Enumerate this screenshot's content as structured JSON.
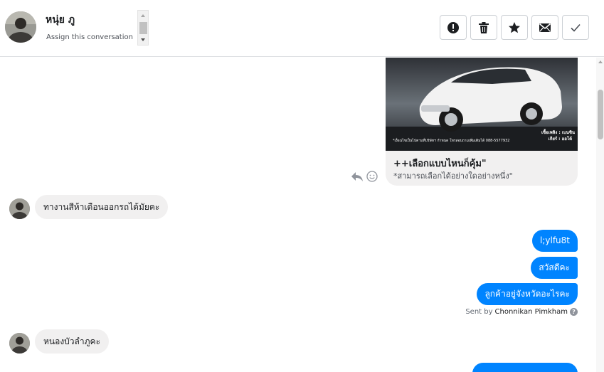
{
  "header": {
    "contact_name": "หนุ่ย ภู",
    "assign_label": "Assign this conversation",
    "actions": [
      {
        "name": "mark-spam-button",
        "icon": "exclamation-circle-icon"
      },
      {
        "name": "delete-button",
        "icon": "trash-icon"
      },
      {
        "name": "star-button",
        "icon": "star-icon"
      },
      {
        "name": "mark-unread-button",
        "icon": "envelope-icon"
      },
      {
        "name": "mark-done-button",
        "icon": "check-icon"
      }
    ]
  },
  "chat": {
    "card": {
      "image_caption_left": "*เงื่อนไขเป็นไปตามที่บริษัทฯ กำหนด โทรสอบถามเพิ่มเติมได้ 088-5577932",
      "image_caption_right_1": "เชื้อเพลิง : เบนซิน",
      "image_caption_right_2": "เกียร์ : ออโต้",
      "title": "++เลือกแบบไหนก็คุ้ม\"",
      "subtitle": "*สามารถเลือกได้อย่างใดอย่างหนึ่ง\""
    },
    "messages": [
      {
        "direction": "in",
        "text": "ทางานสีห้าเดือนออกรถได้มัยคะ"
      },
      {
        "direction": "out",
        "text": "l;ylfu8t"
      },
      {
        "direction": "out",
        "text": "สวัสดีคะ"
      },
      {
        "direction": "out",
        "text": "ลูกค้าอยู่จังหวัดอะไรคะ"
      },
      {
        "direction": "in",
        "text": "หนองบัวลำภูคะ"
      }
    ],
    "sent_by_prefix": "Sent by",
    "sent_by_agent": "Chonnikan Pimkham",
    "help_glyph": "?"
  },
  "colors": {
    "outgoing_bubble": "#0084ff",
    "incoming_bubble": "#f1f0f0",
    "border": "#dddfe2"
  }
}
